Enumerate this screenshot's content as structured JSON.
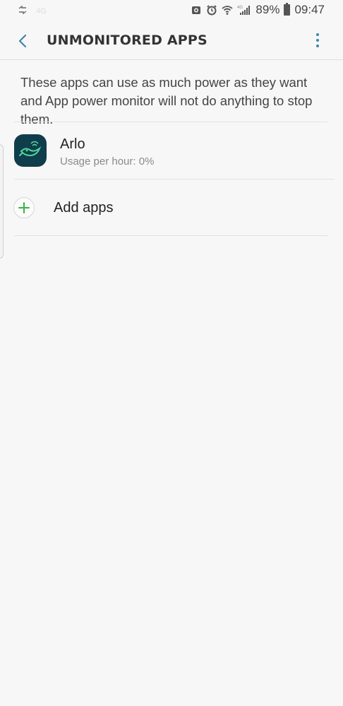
{
  "status_bar": {
    "battery_percent": "89%",
    "time": "09:47",
    "network": "4G",
    "icons": [
      "sync-icon",
      "camera-icon",
      "alarm-icon",
      "wifi-icon",
      "signal-icon",
      "battery-icon"
    ]
  },
  "header": {
    "title": "UNMONITORED APPS",
    "back_icon": "chevron-left-icon",
    "more_icon": "more-vert-icon",
    "accent_color": "#3d87a8"
  },
  "description": "These apps can use as much power as they want and App power monitor will not do anything to stop them.",
  "apps": [
    {
      "name": "Arlo",
      "usage": "Usage per hour: 0%",
      "icon": "arlo-bird-icon",
      "icon_bg": "#0f3d4c"
    }
  ],
  "add_apps": {
    "label": "Add apps",
    "icon": "plus-icon",
    "icon_color": "#3cae4a"
  }
}
